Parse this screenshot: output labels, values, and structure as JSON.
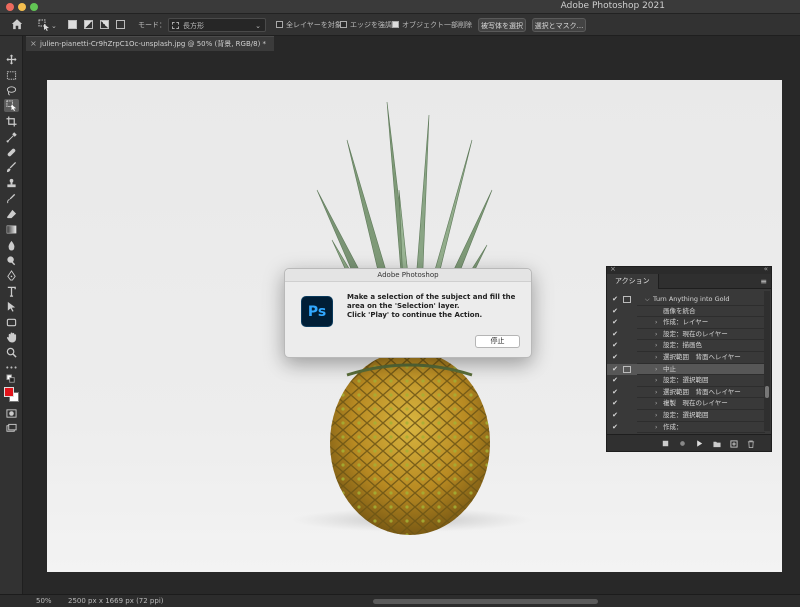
{
  "window": {
    "title": "Adobe Photoshop 2021"
  },
  "options_bar": {
    "mode_label": "モード：",
    "mode_value": "長方形",
    "sample_all_layers": "全レイヤーを対象",
    "enhance_edge": "エッジを強調",
    "object_subtract": "オブジェクト一部削除",
    "select_subject": "被写体を選択",
    "select_and_mask": "選択とマスク..."
  },
  "document_tab": {
    "label": "julien-pianetti-Cr9hZrpC1Oc-unsplash.jpg @ 50% (背景, RGB/8) *",
    "close": "×"
  },
  "toolbar": {
    "more": "•••",
    "foreground_color": "#e2141b",
    "background_color": "#ffffff"
  },
  "dialog": {
    "title": "Adobe Photoshop",
    "logo_text": "Ps",
    "message_line1": "Make a selection of the subject and fill the",
    "message_line2": "area on the 'Selection' layer.",
    "message_line3": "Click 'Play' to continue the Action.",
    "stop_button": "停止"
  },
  "actions_panel": {
    "tab": "アクション",
    "rows": [
      {
        "checked": "✔",
        "dialog": true,
        "arrow": "⌵",
        "label": "Turn Anything into Gold",
        "level": 0,
        "selected": false
      },
      {
        "checked": "✔",
        "dialog": false,
        "arrow": "",
        "label": "画像を統合",
        "level": 1,
        "selected": false
      },
      {
        "checked": "✔",
        "dialog": false,
        "arrow": "›",
        "label": "作成：レイヤー",
        "level": 1,
        "selected": false
      },
      {
        "checked": "✔",
        "dialog": false,
        "arrow": "›",
        "label": "設定：現在のレイヤー",
        "level": 1,
        "selected": false
      },
      {
        "checked": "✔",
        "dialog": false,
        "arrow": "›",
        "label": "設定：描画色",
        "level": 1,
        "selected": false
      },
      {
        "checked": "✔",
        "dialog": false,
        "arrow": "›",
        "label": "選択範囲　背面へレイヤー",
        "level": 1,
        "selected": false
      },
      {
        "checked": "✔",
        "dialog": true,
        "arrow": "›",
        "label": "中止",
        "level": 1,
        "selected": true
      },
      {
        "checked": "✔",
        "dialog": false,
        "arrow": "›",
        "label": "設定：選択範囲",
        "level": 1,
        "selected": false
      },
      {
        "checked": "✔",
        "dialog": false,
        "arrow": "›",
        "label": "選択範囲　背面へレイヤー",
        "level": 1,
        "selected": false
      },
      {
        "checked": "✔",
        "dialog": false,
        "arrow": "›",
        "label": "複製　現在のレイヤー",
        "level": 1,
        "selected": false
      },
      {
        "checked": "✔",
        "dialog": false,
        "arrow": "›",
        "label": "設定：選択範囲",
        "level": 1,
        "selected": false
      },
      {
        "checked": "✔",
        "dialog": false,
        "arrow": "›",
        "label": "作成：",
        "level": 1,
        "selected": false
      }
    ]
  },
  "status_bar": {
    "zoom": "50%",
    "doc_size": "2500 px x 1669 px (72 ppi)"
  }
}
